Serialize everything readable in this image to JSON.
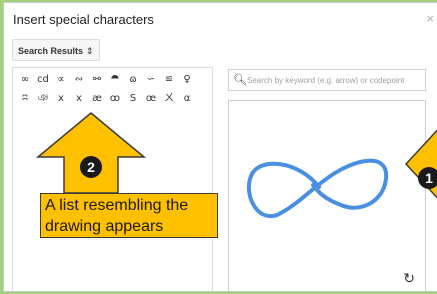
{
  "dialog": {
    "title": "Insert special characters",
    "close_symbol": "×"
  },
  "category": {
    "selected": "Search Results",
    "chevron": "⇕"
  },
  "results": {
    "characters": [
      "∞",
      "cd",
      "∝",
      "∾",
      "⚯",
      "⯊",
      "ɷ",
      "∽",
      "≌",
      "♀",
      "ʭ",
      "ঞ",
      "x",
      "x",
      "æ",
      "ꝏ",
      "S",
      "œ",
      "ㄨ",
      "α"
    ]
  },
  "search": {
    "icon": "search-icon",
    "placeholder": "Search by keyword (e.g. arrow) or codepoint",
    "value": ""
  },
  "drawing": {
    "stroke_color": "#4a90e2",
    "reset_icon": "rotate-ccw-icon",
    "reset_symbol": "↻"
  },
  "annotations": {
    "step2_number": "2",
    "step2_text": "A list resembling the drawing appears",
    "step1_number": "1",
    "arrow_color": "#ffc000"
  }
}
